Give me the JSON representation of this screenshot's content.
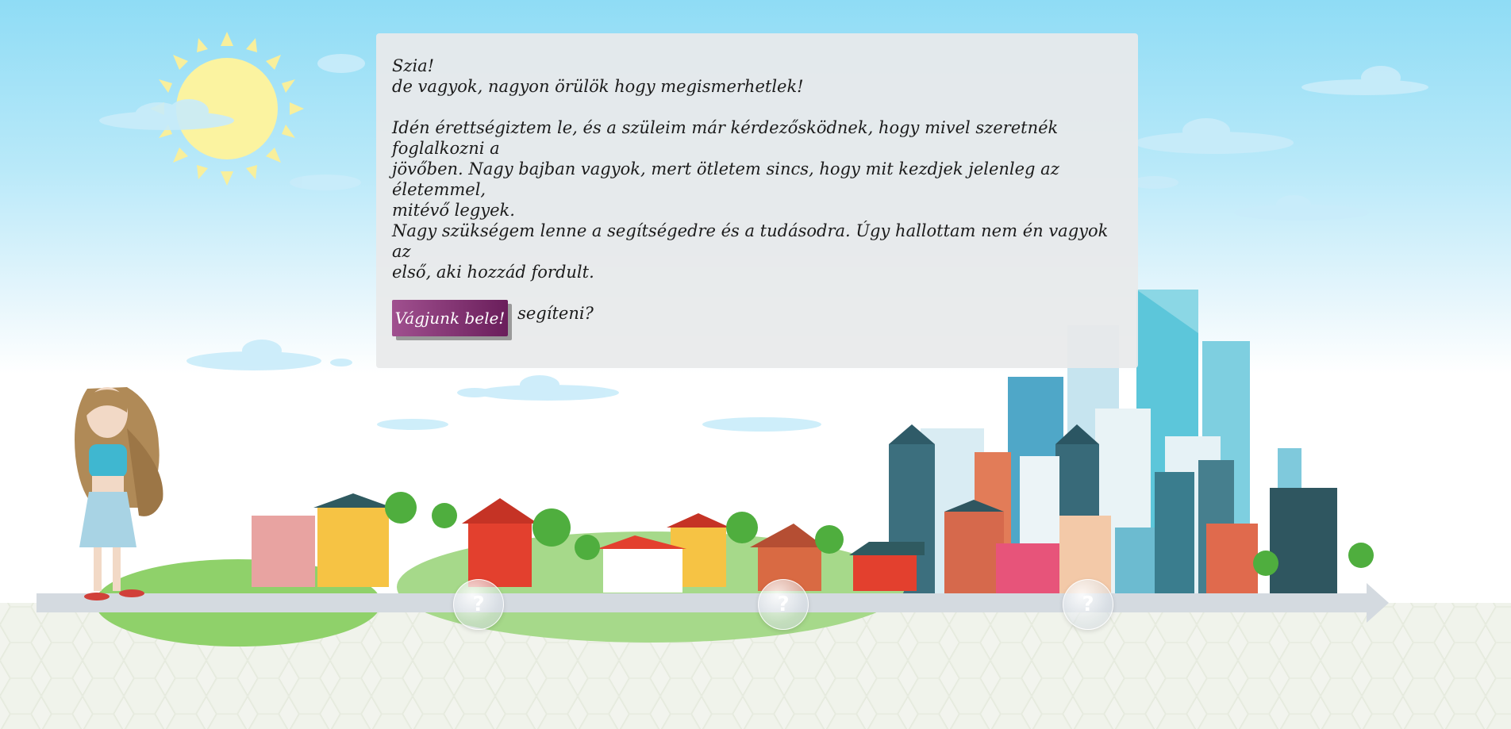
{
  "intro": {
    "greeting": "Szia!",
    "line2": "de vagyok, nagyon örülök hogy megismerhetlek!",
    "paragraph1": "Idén érettségiztem le, és a szüleim már kérdezősködnek, hogy mivel szeretnék foglalkozni a\njövőben. Nagy bajban vagyok, mert ötletem sincs, hogy mit kezdjek jelenleg az életemmel,\nmitévő legyek.",
    "paragraph2": "Nagy szükségem lenne a segítségedre és a tudásodra. Úgy hallottam nem én vagyok az\nelső, aki hozzád fordult.",
    "question": "Tudnál nekem segíteni?",
    "button_label": "Vágjunk bele!"
  },
  "path": {
    "stations": [
      {
        "label": "?"
      },
      {
        "label": "?"
      },
      {
        "label": "?"
      }
    ]
  },
  "colors": {
    "button_start": "#a0508f",
    "button_end": "#6a1e5b",
    "sky": "#8fdcf5",
    "road": "#d3d9df"
  }
}
